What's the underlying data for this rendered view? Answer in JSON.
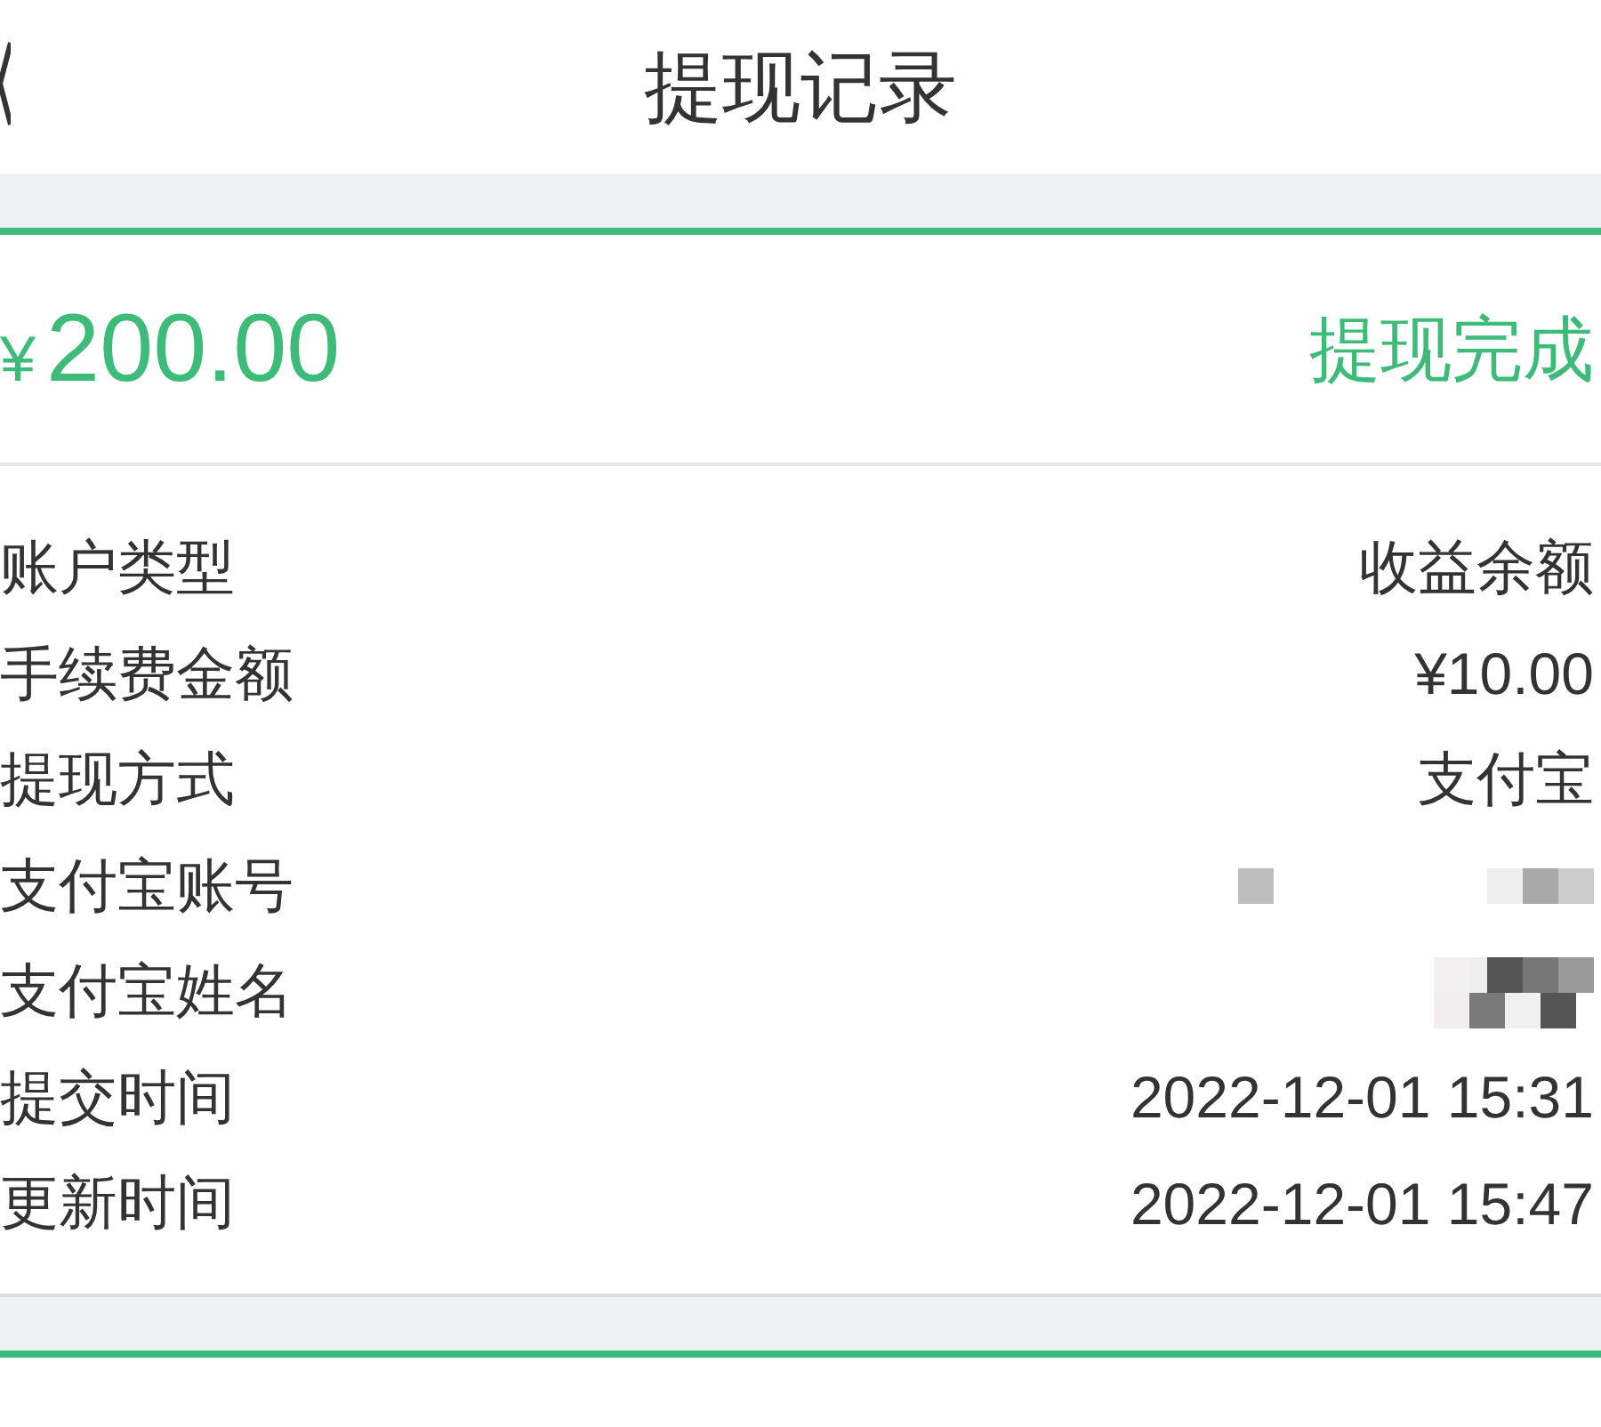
{
  "header": {
    "title": "提现记录"
  },
  "record": {
    "currency": "¥",
    "amount": "200.00",
    "status": "提现完成",
    "rows": [
      {
        "label": "账户类型",
        "kind": "text",
        "value": "收益余额"
      },
      {
        "label": "手续费金额",
        "kind": "text",
        "value": "¥10.00"
      },
      {
        "label": "提现方式",
        "kind": "text",
        "value": "支付宝"
      },
      {
        "label": "支付宝账号",
        "kind": "redacted"
      },
      {
        "label": "支付宝姓名",
        "kind": "redacted"
      },
      {
        "label": "提交时间",
        "kind": "text",
        "value": "2022-12-01 15:31"
      },
      {
        "label": "更新时间",
        "kind": "text",
        "value": "2022-12-01 15:47"
      }
    ]
  }
}
